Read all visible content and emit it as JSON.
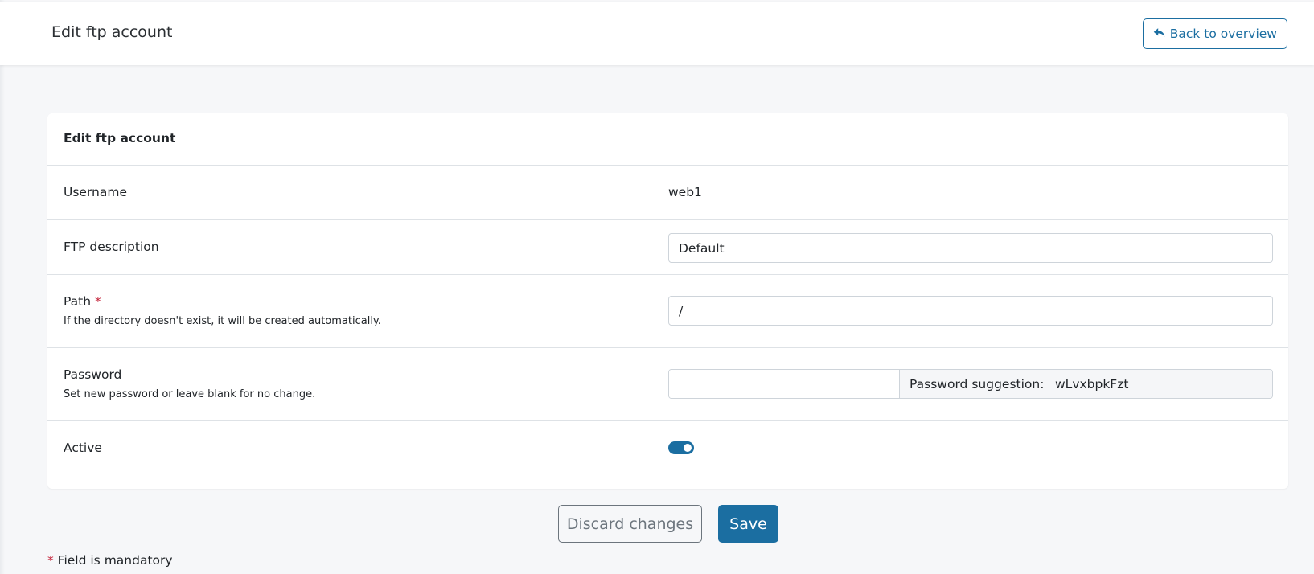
{
  "header": {
    "title": "Edit ftp account",
    "back_label": "Back to overview"
  },
  "card": {
    "title": "Edit ftp account",
    "username": {
      "label": "Username",
      "value": "web1"
    },
    "description": {
      "label": "FTP description",
      "value": "Default"
    },
    "path": {
      "label": "Path",
      "required": "*",
      "help": "If the directory doesn't exist, it will be created automatically.",
      "value": "/"
    },
    "password": {
      "label": "Password",
      "help": "Set new password or leave blank for no change.",
      "value": "",
      "suggestion_label": "Password suggestion:",
      "suggestion_value": "wLvxbpkFzt"
    },
    "active": {
      "label": "Active",
      "checked": true
    }
  },
  "actions": {
    "discard_label": "Discard changes",
    "save_label": "Save"
  },
  "footer": {
    "required_star": "*",
    "mandatory_text": " Field is mandatory"
  },
  "colors": {
    "accent": "#1b6ea1",
    "required": "#c4253c"
  },
  "icons": {
    "back": "reply-arrow-icon"
  }
}
